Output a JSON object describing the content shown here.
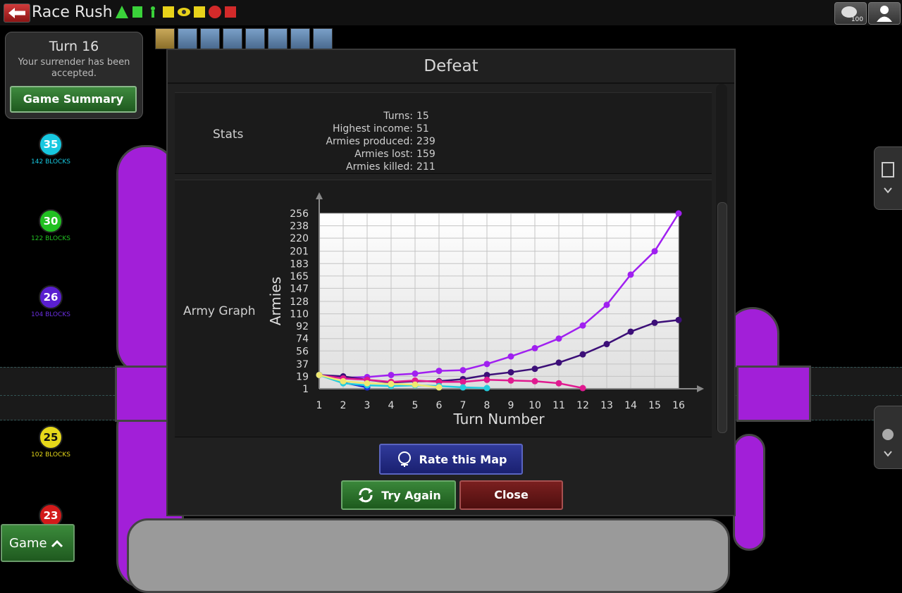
{
  "app": {
    "title": "Race Rush",
    "chat_badge": "100"
  },
  "turn_panel": {
    "turn_label": "Turn 16",
    "message": "Your surrender has been accepted.",
    "summary_button": "Game Summary"
  },
  "game_button": "Game",
  "players": [
    {
      "count": "35",
      "blocks": "142 BLOCKS",
      "color": "#17c8e0"
    },
    {
      "count": "30",
      "blocks": "122 BLOCKS",
      "color": "#22c022"
    },
    {
      "count": "26",
      "blocks": "104 BLOCKS",
      "color": "#5a1fd0"
    },
    {
      "count": "25",
      "blocks": "102 BLOCKS",
      "color": "#e6d81a"
    },
    {
      "count": "23",
      "blocks": "",
      "color": "#d21a1a"
    }
  ],
  "modal": {
    "title": "Defeat",
    "stats_label": "Stats",
    "stats": [
      {
        "label": "Turns:",
        "value": "15"
      },
      {
        "label": "Highest income:",
        "value": "51"
      },
      {
        "label": "Armies produced:",
        "value": "239"
      },
      {
        "label": "Armies lost:",
        "value": "159"
      },
      {
        "label": "Armies killed:",
        "value": "211"
      }
    ],
    "graph_label": "Army Graph",
    "buttons": {
      "rate": "Rate this Map",
      "try_again": "Try Again",
      "close": "Close"
    }
  },
  "chart_data": {
    "type": "line",
    "xlabel": "Turn Number",
    "ylabel": "Armies",
    "x_ticks": [
      "1",
      "2",
      "3",
      "4",
      "5",
      "6",
      "7",
      "8",
      "9",
      "10",
      "11",
      "12",
      "13",
      "14",
      "15",
      "16"
    ],
    "y_ticks": [
      "1",
      "19",
      "37",
      "56",
      "74",
      "92",
      "110",
      "128",
      "147",
      "165",
      "183",
      "201",
      "220",
      "238",
      "256"
    ],
    "xlim": [
      1,
      16
    ],
    "ylim": [
      1,
      256
    ],
    "grid": true,
    "series": [
      {
        "color": "#a020f0",
        "points": [
          [
            1,
            21
          ],
          [
            2,
            17
          ],
          [
            3,
            18
          ],
          [
            4,
            21
          ],
          [
            5,
            23
          ],
          [
            6,
            27
          ],
          [
            7,
            28
          ],
          [
            8,
            37
          ],
          [
            9,
            48
          ],
          [
            10,
            60
          ],
          [
            11,
            74
          ],
          [
            12,
            93
          ],
          [
            13,
            123
          ],
          [
            14,
            167
          ],
          [
            15,
            201
          ],
          [
            16,
            256
          ]
        ]
      },
      {
        "color": "#3c0f78",
        "points": [
          [
            1,
            21
          ],
          [
            2,
            19
          ],
          [
            3,
            14
          ],
          [
            4,
            10
          ],
          [
            5,
            12
          ],
          [
            6,
            12
          ],
          [
            7,
            15
          ],
          [
            8,
            21
          ],
          [
            9,
            25
          ],
          [
            10,
            30
          ],
          [
            11,
            39
          ],
          [
            12,
            51
          ],
          [
            13,
            66
          ],
          [
            14,
            84
          ],
          [
            15,
            97
          ],
          [
            16,
            101
          ]
        ]
      },
      {
        "color": "#e01a90",
        "points": [
          [
            1,
            21
          ],
          [
            2,
            16
          ],
          [
            3,
            14
          ],
          [
            4,
            11
          ],
          [
            5,
            13
          ],
          [
            6,
            11
          ],
          [
            7,
            11
          ],
          [
            8,
            14
          ],
          [
            9,
            13
          ],
          [
            10,
            12
          ],
          [
            11,
            9
          ],
          [
            12,
            2
          ]
        ]
      },
      {
        "color": "#1a2ad8",
        "points": [
          [
            1,
            21
          ],
          [
            2,
            10
          ],
          [
            3,
            3
          ]
        ]
      },
      {
        "color": "#22ccdd",
        "points": [
          [
            1,
            21
          ],
          [
            2,
            9
          ],
          [
            3,
            6
          ],
          [
            4,
            5
          ],
          [
            5,
            6
          ],
          [
            6,
            5
          ],
          [
            7,
            3
          ],
          [
            8,
            2
          ]
        ]
      },
      {
        "color": "#f0e870",
        "points": [
          [
            1,
            21
          ],
          [
            2,
            12
          ],
          [
            3,
            9
          ],
          [
            4,
            8
          ],
          [
            5,
            7
          ],
          [
            6,
            3
          ]
        ]
      }
    ]
  }
}
